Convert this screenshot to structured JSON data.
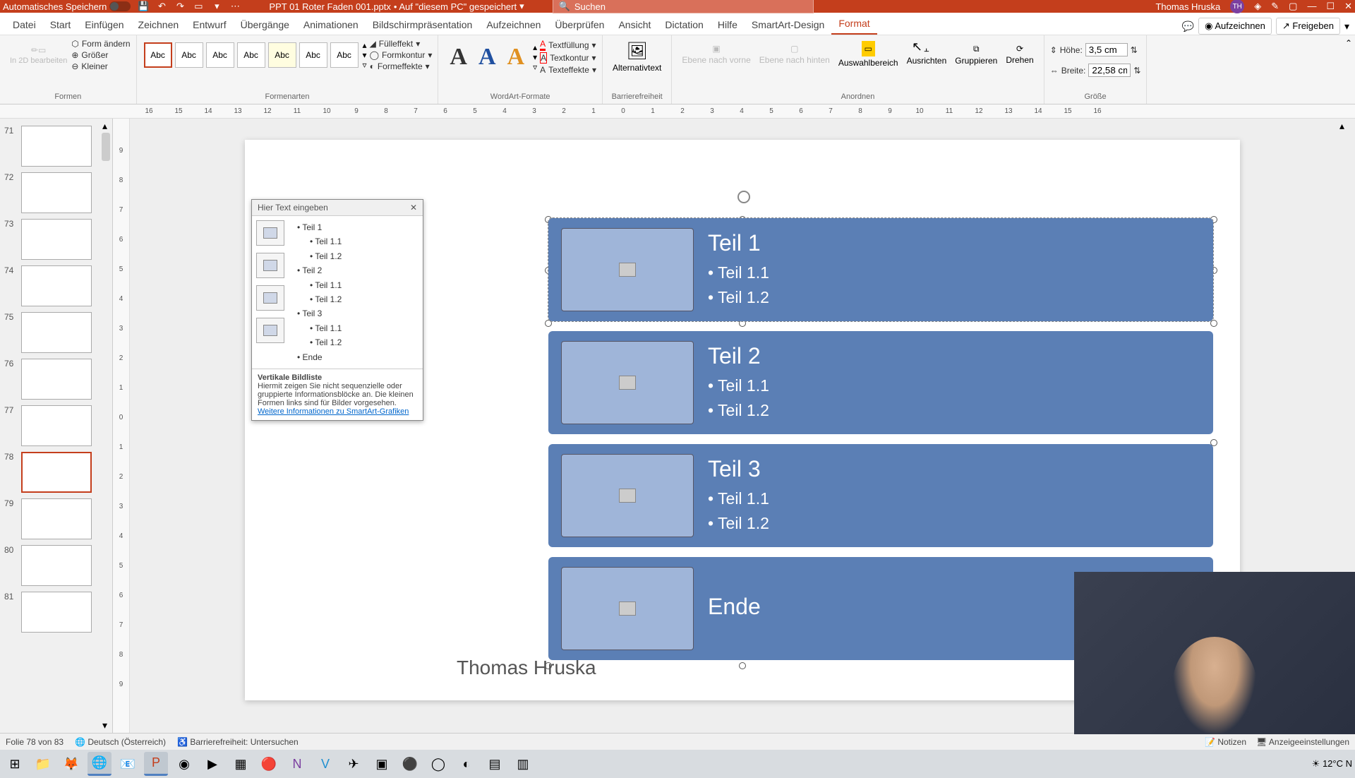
{
  "titlebar": {
    "autosave": "Automatisches Speichern",
    "doc_name": "PPT 01 Roter Faden 001.pptx",
    "saved_loc": "• Auf \"diesem PC\" gespeichert",
    "search_placeholder": "Suchen",
    "user_name": "Thomas Hruska",
    "user_initials": "TH"
  },
  "tabs": {
    "items": [
      "Datei",
      "Start",
      "Einfügen",
      "Zeichnen",
      "Entwurf",
      "Übergänge",
      "Animationen",
      "Bildschirmpräsentation",
      "Aufzeichnen",
      "Überprüfen",
      "Ansicht",
      "Dictation",
      "Hilfe",
      "SmartArt-Design",
      "Format"
    ],
    "active": "Format",
    "record": "Aufzeichnen",
    "share": "Freigeben"
  },
  "ribbon": {
    "shapes_edit": "In 2D bearbeiten",
    "change_shape": "Form ändern",
    "larger": "Größer",
    "smaller": "Kleiner",
    "g_shapes": "Formen",
    "style_label": "Abc",
    "g_styles": "Formenarten",
    "fill": "Fülleffekt",
    "outline": "Formkontur",
    "effects": "Formeffekte",
    "g_wordart": "WordArt-Formate",
    "wa_letter": "A",
    "textfill": "Textfüllung",
    "textoutline": "Textkontur",
    "texteffects": "Texteffekte",
    "alttext": "Alternativtext",
    "g_access": "Barrierefreiheit",
    "front": "Ebene nach vorne",
    "back": "Ebene nach hinten",
    "selection": "Auswahlbereich",
    "align": "Ausrichten",
    "group": "Gruppieren",
    "rotate": "Drehen",
    "g_arrange": "Anordnen",
    "height_l": "Höhe:",
    "height_v": "3,5 cm",
    "width_l": "Breite:",
    "width_v": "22,58 cm",
    "g_size": "Größe"
  },
  "ruler_h": [
    "16",
    "15",
    "14",
    "13",
    "12",
    "11",
    "10",
    "9",
    "8",
    "7",
    "6",
    "5",
    "4",
    "3",
    "2",
    "1",
    "0",
    "1",
    "2",
    "3",
    "4",
    "5",
    "6",
    "7",
    "8",
    "9",
    "10",
    "11",
    "12",
    "13",
    "14",
    "15",
    "16"
  ],
  "ruler_v": [
    "9",
    "8",
    "7",
    "6",
    "5",
    "4",
    "3",
    "2",
    "1",
    "0",
    "1",
    "2",
    "3",
    "4",
    "5",
    "6",
    "7",
    "8",
    "9"
  ],
  "thumbs": [
    {
      "num": "71"
    },
    {
      "num": "72"
    },
    {
      "num": "73"
    },
    {
      "num": "74"
    },
    {
      "num": "75"
    },
    {
      "num": "76"
    },
    {
      "num": "77"
    },
    {
      "num": "78",
      "selected": true
    },
    {
      "num": "79"
    },
    {
      "num": "80"
    },
    {
      "num": "81"
    }
  ],
  "textpane": {
    "title": "Hier Text eingeben",
    "items": [
      {
        "l": 1,
        "t": "Teil 1"
      },
      {
        "l": 2,
        "t": "Teil 1.1"
      },
      {
        "l": 2,
        "t": "Teil 1.2"
      },
      {
        "l": 1,
        "t": "Teil 2"
      },
      {
        "l": 2,
        "t": "Teil 1.1"
      },
      {
        "l": 2,
        "t": "Teil 1.2"
      },
      {
        "l": 1,
        "t": "Teil 3"
      },
      {
        "l": 2,
        "t": "Teil 1.1"
      },
      {
        "l": 2,
        "t": "Teil 1.2"
      },
      {
        "l": 1,
        "t": "Ende"
      }
    ],
    "foot_title": "Vertikale Bildliste",
    "foot_desc": "Hiermit zeigen Sie nicht sequenzielle oder gruppierte Informationsblöcke an. Die kleinen Formen links sind für Bilder vorgesehen.",
    "foot_link": "Weitere Informationen zu SmartArt-Grafiken"
  },
  "smartart": {
    "items": [
      {
        "title": "Teil 1",
        "b1": "Teil 1.1",
        "b2": "Teil 1.2"
      },
      {
        "title": "Teil 2",
        "b1": "Teil 1.1",
        "b2": "Teil 1.2"
      },
      {
        "title": "Teil 3",
        "b1": "Teil 1.1",
        "b2": "Teil 1.2"
      },
      {
        "title": "Ende"
      }
    ]
  },
  "slide_footer": "Thomas Hruska",
  "status": {
    "slide": "Folie 78 von 83",
    "lang": "Deutsch (Österreich)",
    "access": "Barrierefreiheit: Untersuchen",
    "notes": "Notizen",
    "display": "Anzeigeeinstellungen"
  },
  "taskbar": {
    "weather": "12°C",
    "weather_label": "N"
  }
}
